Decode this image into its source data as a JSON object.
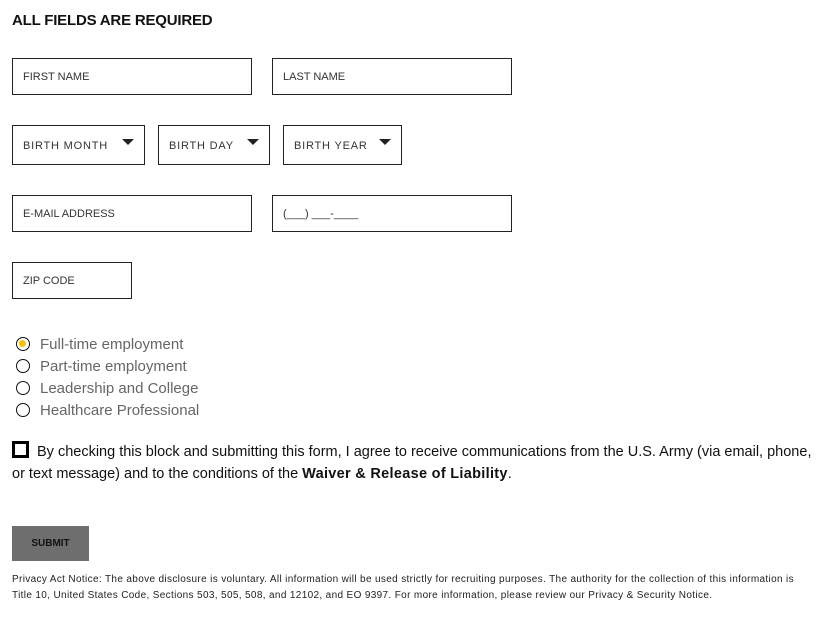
{
  "form": {
    "heading": "ALL FIELDS ARE REQUIRED",
    "fields": {
      "first_name": {
        "value": "",
        "placeholder": "FIRST NAME"
      },
      "last_name": {
        "value": "",
        "placeholder": "LAST NAME"
      },
      "email": {
        "value": "",
        "placeholder": "E-MAIL ADDRESS"
      },
      "phone": {
        "value": "",
        "placeholder": "(___) ___-____"
      },
      "zip": {
        "value": "",
        "placeholder": "ZIP CODE"
      }
    },
    "selects": {
      "birth_month": {
        "label": "BIRTH MONTH",
        "icon": "caret-down-icon"
      },
      "birth_day": {
        "label": "BIRTH DAY",
        "icon": "caret-down-icon"
      },
      "birth_year": {
        "label": "BIRTH YEAR",
        "icon": "caret-down-icon"
      }
    },
    "radio_options": [
      {
        "label": "Full-time employment",
        "checked": true
      },
      {
        "label": "Part-time employment",
        "checked": false
      },
      {
        "label": "Leadership and College",
        "checked": false
      },
      {
        "label": "Healthcare Professional",
        "checked": false
      }
    ],
    "consent": {
      "checked": false,
      "text": "By checking this block and submitting this form, I agree to receive communications from the U.S. Army (via email, phone, or text message) and to the conditions of the ",
      "link_text": "Waiver & Release of Liability",
      "suffix": "."
    },
    "submit_label": "SUBMIT",
    "privacy": {
      "text": "Privacy Act Notice: The above disclosure is voluntary. All information will be used strictly for recruiting purposes. The authority for the collection of this information is Title 10, United States Code, Sections 503, 505, 508, and 12102, and EO 9397. For more information, please review our ",
      "link_text": "Privacy & Security Notice",
      "suffix": "."
    },
    "colors": {
      "radio_selected": "#f5c400",
      "submit_bg": "#6e6e6e"
    }
  }
}
